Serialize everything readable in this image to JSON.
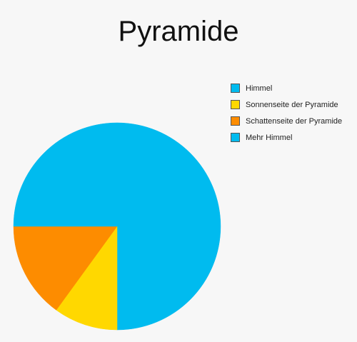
{
  "chart_data": {
    "type": "pie",
    "title": "Pyramide",
    "legend_position": "top-right",
    "start_angle_deg": 0,
    "slices": [
      {
        "label": "Himmel",
        "value": 0.5,
        "color": "#00bbef"
      },
      {
        "label": "Sonnenseite der Pyramide",
        "value": 0.1,
        "color": "#ffd800"
      },
      {
        "label": "Schattenseite der Pyramide",
        "value": 0.15,
        "color": "#fd8c00"
      },
      {
        "label": "Mehr Himmel",
        "value": 0.25,
        "color": "#00bbef"
      }
    ],
    "legend": [
      {
        "label": "Himmel",
        "color": "#00bbef"
      },
      {
        "label": "Sonnenseite der Pyramide",
        "color": "#ffd800"
      },
      {
        "label": "Schattenseite der Pyramide",
        "color": "#fd8c00"
      },
      {
        "label": "Mehr Himmel",
        "color": "#00bbef"
      }
    ]
  }
}
